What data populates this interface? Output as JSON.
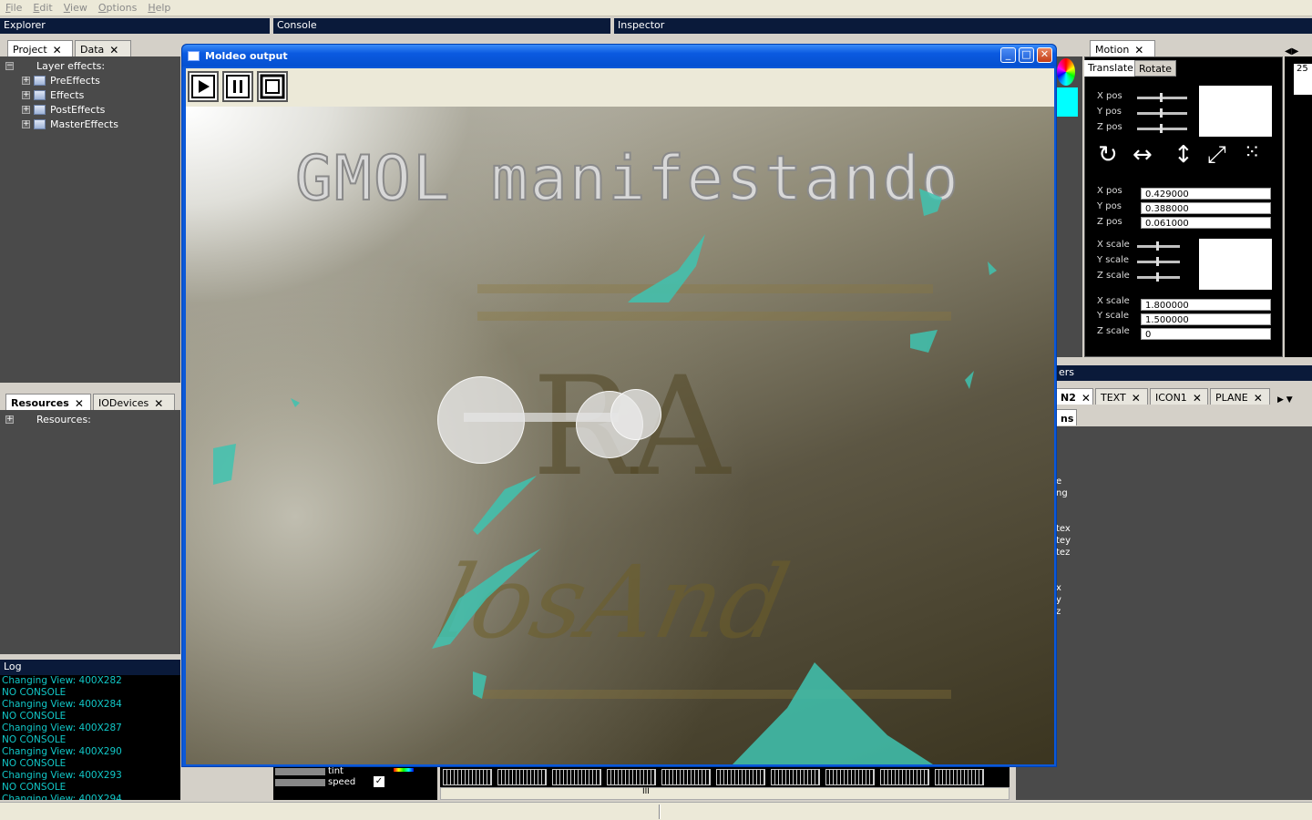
{
  "menu": [
    "File",
    "Edit",
    "View",
    "Options",
    "Help"
  ],
  "explorer": {
    "title": "Explorer",
    "tabs": [
      "Project",
      "Data"
    ],
    "tree_root": "Layer effects:",
    "tree_items": [
      "PreEffects",
      "Effects",
      "PostEffects",
      "MasterEffects"
    ]
  },
  "resources": {
    "tabs": [
      "Resources",
      "IODevices"
    ],
    "root": "Resources:"
  },
  "log": {
    "title": "Log",
    "lines": [
      "Changing View: 400X282",
      "NO CONSOLE",
      "Changing View: 400X284",
      "NO CONSOLE",
      "Changing View: 400X287",
      "NO CONSOLE",
      "Changing View: 400X290",
      "NO CONSOLE",
      "Changing View: 400X293",
      "NO CONSOLE",
      "Changing View: 400X294"
    ]
  },
  "console": {
    "title": "Console"
  },
  "inspector": {
    "title": "Inspector"
  },
  "output_window": {
    "title": "Moldeo output",
    "overlay_text": "GMOL manifestando",
    "watermark_large": "RA",
    "watermark_script": "losAnd"
  },
  "motion": {
    "tab": "Motion",
    "subtabs": [
      "Translate",
      "Rotate"
    ],
    "pos_labels": [
      "X pos",
      "Y pos",
      "Z pos"
    ],
    "pos_values": [
      "0.429000",
      "0.388000",
      "0.061000"
    ],
    "scale_labels": [
      "X scale",
      "Y scale",
      "Z scale"
    ],
    "scale_values": [
      "1.800000",
      "1.500000",
      "0"
    ],
    "right_value": "25"
  },
  "layers": {
    "title_fragment": "ers",
    "tabs": [
      "N2",
      "TEXT",
      "ICON1",
      "PLANE"
    ],
    "subtab": "ns",
    "side_fragments": [
      "e",
      "ng",
      "tex",
      "tey",
      "tez",
      "x",
      "y",
      "z"
    ]
  },
  "console_bottom": {
    "labels": [
      "tint",
      "speed"
    ],
    "checked": true,
    "scroll_mark": "III"
  },
  "colors": {
    "log_text": "#11c7c7",
    "panel_dark": "#4a4a4a",
    "xp_blue": "#0b58d8",
    "teal": "#3fc3b0"
  }
}
